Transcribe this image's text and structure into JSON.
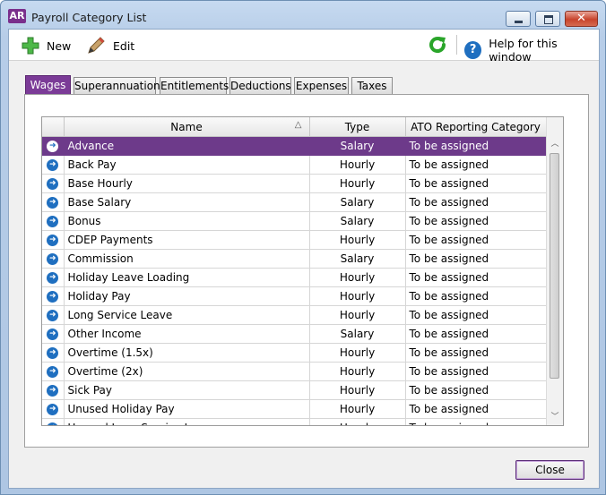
{
  "window": {
    "app_badge": "AR",
    "title": "Payroll Category List"
  },
  "toolbar": {
    "new_label": "New",
    "edit_label": "Edit",
    "help_label": "Help for this window"
  },
  "tabs": [
    {
      "label": "Wages",
      "active": true
    },
    {
      "label": "Superannuation",
      "active": false
    },
    {
      "label": "Entitlements",
      "active": false
    },
    {
      "label": "Deductions",
      "active": false
    },
    {
      "label": "Expenses",
      "active": false
    },
    {
      "label": "Taxes",
      "active": false
    }
  ],
  "table": {
    "columns": {
      "name": "Name",
      "type": "Type",
      "ato": "ATO Reporting Category"
    },
    "sort_indicator": "△",
    "rows": [
      {
        "name": "Advance",
        "type": "Salary",
        "ato": "To be assigned",
        "selected": true
      },
      {
        "name": "Back Pay",
        "type": "Hourly",
        "ato": "To be assigned"
      },
      {
        "name": "Base Hourly",
        "type": "Hourly",
        "ato": "To be assigned"
      },
      {
        "name": "Base Salary",
        "type": "Salary",
        "ato": "To be assigned"
      },
      {
        "name": "Bonus",
        "type": "Salary",
        "ato": "To be assigned"
      },
      {
        "name": "CDEP Payments",
        "type": "Hourly",
        "ato": "To be assigned"
      },
      {
        "name": "Commission",
        "type": "Salary",
        "ato": "To be assigned"
      },
      {
        "name": "Holiday Leave Loading",
        "type": "Hourly",
        "ato": "To be assigned"
      },
      {
        "name": "Holiday Pay",
        "type": "Hourly",
        "ato": "To be assigned"
      },
      {
        "name": "Long Service Leave",
        "type": "Hourly",
        "ato": "To be assigned"
      },
      {
        "name": "Other Income",
        "type": "Salary",
        "ato": "To be assigned"
      },
      {
        "name": "Overtime (1.5x)",
        "type": "Hourly",
        "ato": "To be assigned"
      },
      {
        "name": "Overtime (2x)",
        "type": "Hourly",
        "ato": "To be assigned"
      },
      {
        "name": "Sick Pay",
        "type": "Hourly",
        "ato": "To be assigned"
      },
      {
        "name": "Unused Holiday Pay",
        "type": "Hourly",
        "ato": "To be assigned"
      },
      {
        "name": "Unused Long Service Leave",
        "type": "Hourly",
        "ato": "To be assigned"
      }
    ]
  },
  "footer": {
    "close_label": "Close"
  },
  "colors": {
    "accent": "#7b3b97",
    "selection": "#6d3a8a",
    "icon_blue": "#1f6fc0",
    "refresh_green": "#2aa52a"
  }
}
